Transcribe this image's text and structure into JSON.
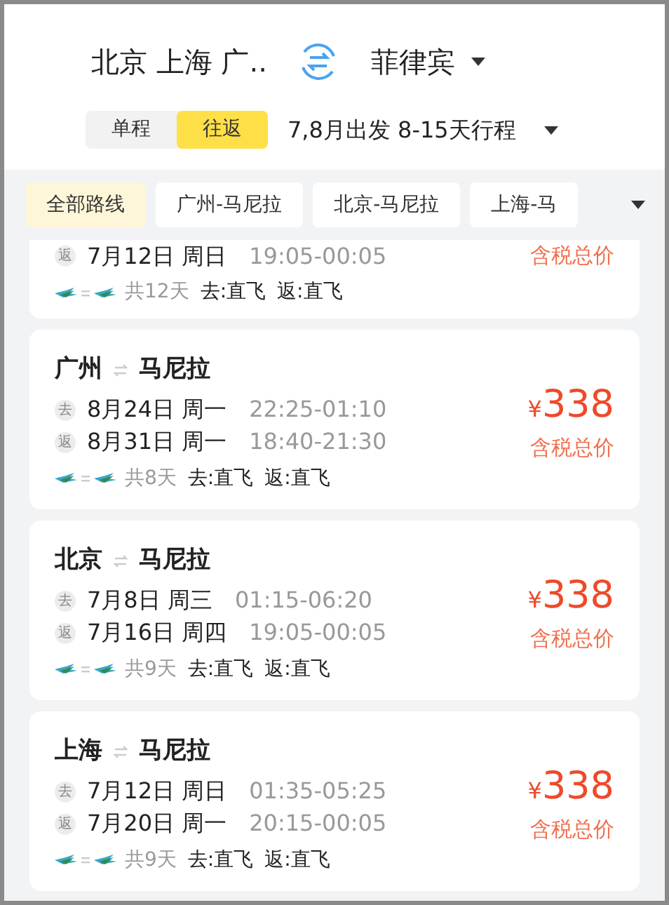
{
  "header": {
    "origin": "北京 上海 广..",
    "destination": "菲律宾"
  },
  "trip_types": [
    {
      "label": "单程",
      "selected": false
    },
    {
      "label": "往返",
      "selected": true
    }
  ],
  "date_filter": "7,8月出发 8-15天行程",
  "routes": [
    {
      "label": "全部路线",
      "selected": true
    },
    {
      "label": "广州-马尼拉",
      "selected": false
    },
    {
      "label": "北京-马尼拉",
      "selected": false
    },
    {
      "label": "上海-马",
      "selected": false
    }
  ],
  "partial_card": {
    "return": {
      "badge": "返",
      "date": "7月12日 周日",
      "time": "19:05-00:05"
    },
    "days": "共12天",
    "out_type": "去:直飞",
    "back_type": "返:直飞",
    "price_label": "含税总价"
  },
  "cards": [
    {
      "from": "广州",
      "to": "马尼拉",
      "legs": [
        {
          "badge": "去",
          "date": "8月24日 周一",
          "time": "22:25-01:10"
        },
        {
          "badge": "返",
          "date": "8月31日 周一",
          "time": "18:40-21:30"
        }
      ],
      "days": "共8天",
      "out_type": "去:直飞",
      "back_type": "返:直飞",
      "currency": "¥",
      "price": "338",
      "price_label": "含税总价"
    },
    {
      "from": "北京",
      "to": "马尼拉",
      "legs": [
        {
          "badge": "去",
          "date": "7月8日 周三",
          "time": "01:15-06:20"
        },
        {
          "badge": "返",
          "date": "7月16日 周四",
          "time": "19:05-00:05"
        }
      ],
      "days": "共9天",
      "out_type": "去:直飞",
      "back_type": "返:直飞",
      "currency": "¥",
      "price": "338",
      "price_label": "含税总价"
    },
    {
      "from": "上海",
      "to": "马尼拉",
      "legs": [
        {
          "badge": "去",
          "date": "7月12日 周日",
          "time": "01:35-05:25"
        },
        {
          "badge": "返",
          "date": "7月20日 周一",
          "time": "20:15-00:05"
        }
      ],
      "days": "共9天",
      "out_type": "去:直飞",
      "back_type": "返:直飞",
      "currency": "¥",
      "price": "338",
      "price_label": "含税总价"
    }
  ]
}
